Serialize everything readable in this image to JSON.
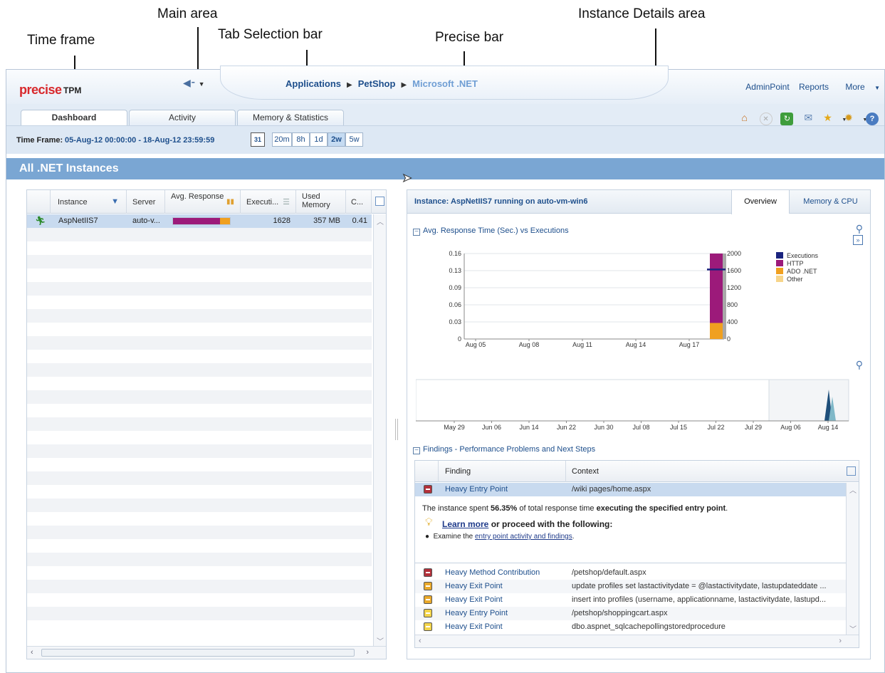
{
  "callouts": {
    "main_area": "Main area",
    "tab_selection_bar": "Tab Selection bar",
    "precise_bar": "Precise bar",
    "instance_details_area": "Instance Details area",
    "time_frame": "Time frame"
  },
  "brand": {
    "logo": "precise",
    "product": "TPM"
  },
  "breadcrumb": [
    "Applications",
    "PetShop",
    "Microsoft .NET"
  ],
  "top_links": [
    "AdminPoint",
    "Reports",
    "More"
  ],
  "tabs": [
    "Dashboard",
    "Activity",
    "Memory & Statistics"
  ],
  "active_tab": "Dashboard",
  "toolbar_icons": [
    "home-icon",
    "stop-icon",
    "refresh-icon",
    "mail-icon",
    "favorites-icon",
    "settings-icon",
    "help-icon"
  ],
  "time_frame": {
    "label": "Time Frame:",
    "value": "05-Aug-12 00:00:00 - 18-Aug-12 23:59:59",
    "calendar": "31",
    "ranges": [
      "20m",
      "8h",
      "1d",
      "2w",
      "5w"
    ],
    "active_range": "2w"
  },
  "section_header": "All .NET Instances",
  "instances_table": {
    "columns": [
      "Instance",
      "Server",
      "Avg. Response",
      "Executi...",
      "Used Memory",
      "C..."
    ],
    "rows": [
      {
        "instance": "AspNetIIS7",
        "server": "auto-v...",
        "http_share": 0.82,
        "ado_share": 0.18,
        "executions": "1628",
        "used_memory": "357 MB",
        "c": "0.41"
      }
    ]
  },
  "details": {
    "title": "Instance: AspNetIIS7 running on auto-vm-win6",
    "tabs": [
      "Overview",
      "Memory & CPU"
    ],
    "active_tab": "Overview",
    "chart_section": "Avg. Response Time (Sec.) vs Executions",
    "findings_section": "Findings - Performance Problems and Next Steps",
    "findings_columns": [
      "Finding",
      "Context"
    ],
    "selected_finding": {
      "name": "Heavy Entry Point",
      "context": "/wiki pages/home.aspx",
      "severity": "high"
    },
    "description": {
      "prefix": "The instance spent ",
      "pct": "56.35%",
      "middle": " of total response time ",
      "bold_end": "executing the specified entry point",
      "suffix": ".",
      "learn_more": "Learn more",
      "proceed": " or proceed with the following:",
      "bullet_prefix": "Examine the ",
      "bullet_link": "entry point activity and findings",
      "bullet_suffix": "."
    },
    "findings": [
      {
        "name": "Heavy Method Contribution",
        "context": "/petshop/default.aspx",
        "severity": "high"
      },
      {
        "name": "Heavy Exit Point",
        "context": "update profiles set lastactivitydate = @lastactivitydate, lastupdateddate ...",
        "severity": "medium"
      },
      {
        "name": "Heavy Exit Point",
        "context": "insert into profiles (username, applicationname, lastactivitydate, lastupd...",
        "severity": "medium"
      },
      {
        "name": "Heavy Entry Point",
        "context": "/petshop/shoppingcart.aspx",
        "severity": "low"
      },
      {
        "name": "Heavy Exit Point",
        "context": "dbo.aspnet_sqlcachepollingstoredprocedure",
        "severity": "low"
      }
    ]
  },
  "colors": {
    "executions": "#1a237e",
    "http": "#9c1a7a",
    "ado": "#f0a020",
    "other": "#f7d58a",
    "sev_high": "#b3303a",
    "sev_medium": "#eaa92a",
    "sev_low": "#f3d44a",
    "accent": "#1e4f8c"
  },
  "chart_data": [
    {
      "type": "bar",
      "title": "Avg. Response Time (Sec.) vs Executions",
      "categories": [
        "Aug 05",
        "Aug 08",
        "Aug 11",
        "Aug 14",
        "Aug 17"
      ],
      "ylim": [
        0,
        0.16
      ],
      "y_ticks": [
        "0",
        "0.03",
        "0.06",
        "0.09",
        "0.13",
        "0.16"
      ],
      "y2lim": [
        0,
        2000
      ],
      "y2_ticks": [
        "0",
        "400",
        "800",
        "1200",
        "1600",
        "2000"
      ],
      "legend": [
        "Executions",
        "HTTP",
        "ADO .NET",
        "Other"
      ],
      "legend_position": "right",
      "series": [
        {
          "name": "HTTP",
          "x": "Aug 18",
          "value": 0.13
        },
        {
          "name": "ADO .NET",
          "x": "Aug 18",
          "value": 0.03
        },
        {
          "name": "Executions",
          "x": "Aug 18",
          "value": 1628
        }
      ]
    },
    {
      "type": "area",
      "categories": [
        "May 29",
        "Jun 06",
        "Jun 14",
        "Jun 22",
        "Jun 30",
        "Jul 08",
        "Jul 15",
        "Jul 22",
        "Jul 29",
        "Aug 06",
        "Aug 14"
      ],
      "selected_range": [
        "Aug 05",
        "Aug 18"
      ]
    }
  ]
}
